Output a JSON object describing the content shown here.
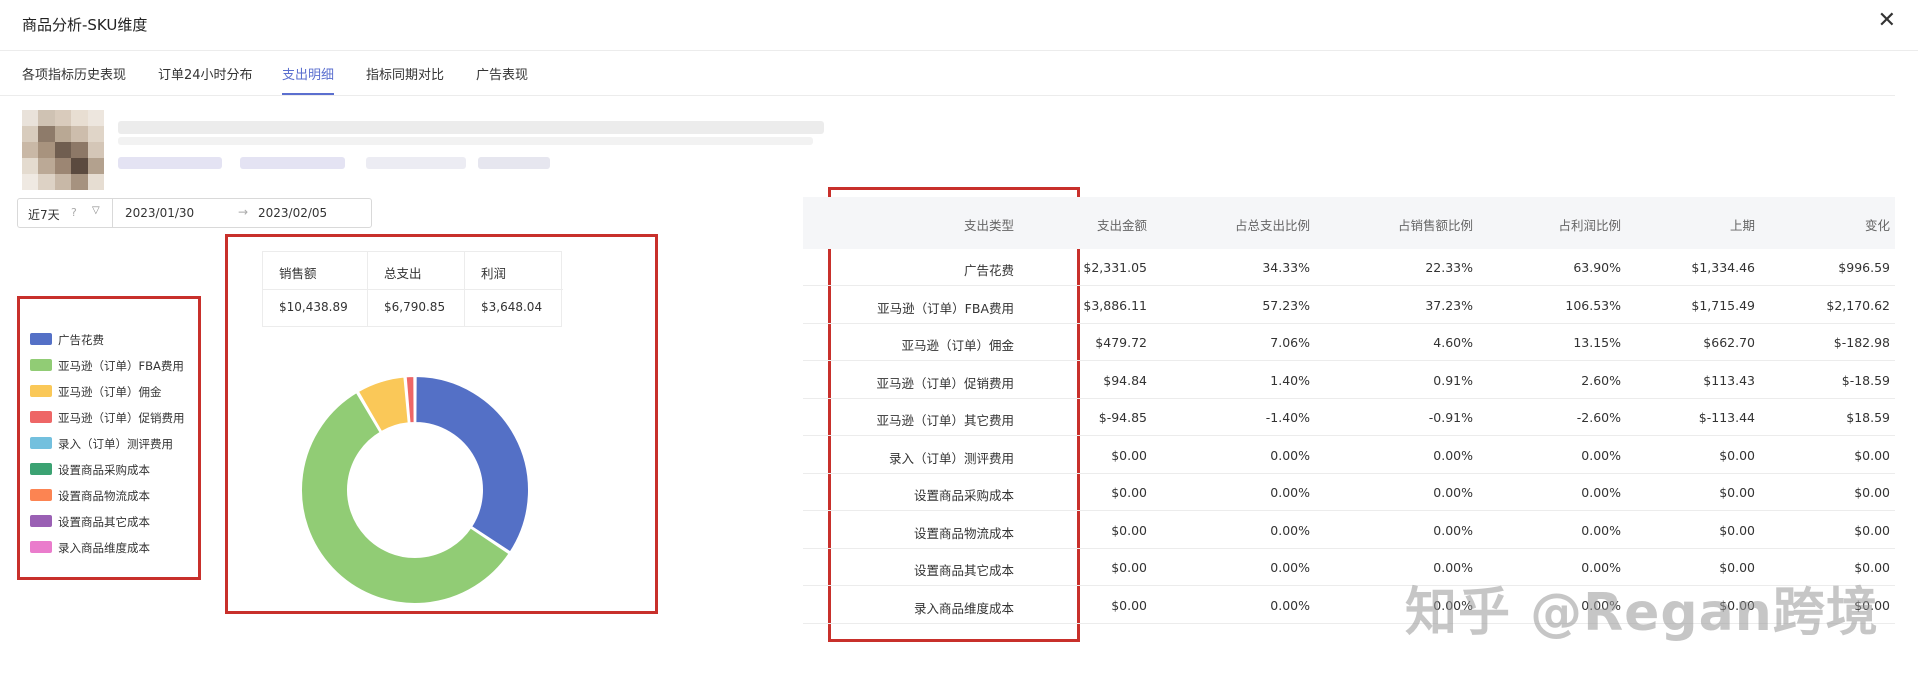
{
  "window": {
    "title": "商品分析-SKU维度",
    "close_label": "✕"
  },
  "tabs": [
    {
      "label": "各项指标历史表现"
    },
    {
      "label": "订单24小时分布"
    },
    {
      "label": "支出明细",
      "active": true
    },
    {
      "label": "指标同期对比"
    },
    {
      "label": "广告表现"
    }
  ],
  "date_range": {
    "preset": "近7天",
    "preset_icon": "help-circle-icon",
    "start": "2023/01/30",
    "arrow": "→",
    "end": "2023/02/05"
  },
  "legend": [
    {
      "label": "广告花费",
      "color": "#5470c6"
    },
    {
      "label": "亚马逊（订单）FBA费用",
      "color": "#91cc75"
    },
    {
      "label": "亚马逊（订单）佣金",
      "color": "#fac858"
    },
    {
      "label": "亚马逊（订单）促销费用",
      "color": "#ee6666"
    },
    {
      "label": "录入（订单）测评费用",
      "color": "#73c0de"
    },
    {
      "label": "设置商品采购成本",
      "color": "#3ba272"
    },
    {
      "label": "设置商品物流成本",
      "color": "#fc8452"
    },
    {
      "label": "设置商品其它成本",
      "color": "#9a60b4"
    },
    {
      "label": "录入商品维度成本",
      "color": "#ea7ccc"
    }
  ],
  "summary": {
    "headers": [
      "销售额",
      "总支出",
      "利润"
    ],
    "values": [
      "$10,438.89",
      "$6,790.85",
      "$3,648.04"
    ]
  },
  "chart_data": {
    "type": "pie",
    "donut": true,
    "labels": [
      "广告花费",
      "亚马逊（订单）FBA费用",
      "亚马逊（订单）佣金",
      "亚马逊（订单）促销费用",
      "亚马逊（订单）其它费用",
      "录入（订单）测评费用",
      "设置商品采购成本",
      "设置商品物流成本",
      "设置商品其它成本",
      "录入商品维度成本"
    ],
    "values": [
      2331.05,
      3886.11,
      479.72,
      94.84,
      -94.85,
      0,
      0,
      0,
      0,
      0
    ],
    "colors": [
      "#5470c6",
      "#91cc75",
      "#fac858",
      "#ee6666",
      "#73c0de",
      "#3ba272",
      "#fc8452",
      "#9a60b4",
      "#ea7ccc",
      "#5470c6"
    ]
  },
  "table": {
    "headers": [
      "支出类型",
      "支出金额",
      "占总支出比例",
      "占销售额比例",
      "占利润比例",
      "上期",
      "变化"
    ],
    "rows": [
      [
        "广告花费",
        "$2,331.05",
        "34.33%",
        "22.33%",
        "63.90%",
        "$1,334.46",
        "$996.59"
      ],
      [
        "亚马逊（订单）FBA费用",
        "$3,886.11",
        "57.23%",
        "37.23%",
        "106.53%",
        "$1,715.49",
        "$2,170.62"
      ],
      [
        "亚马逊（订单）佣金",
        "$479.72",
        "7.06%",
        "4.60%",
        "13.15%",
        "$662.70",
        "$-182.98"
      ],
      [
        "亚马逊（订单）促销费用",
        "$94.84",
        "1.40%",
        "0.91%",
        "2.60%",
        "$113.43",
        "$-18.59"
      ],
      [
        "亚马逊（订单）其它费用",
        "$-94.85",
        "-1.40%",
        "-0.91%",
        "-2.60%",
        "$-113.44",
        "$18.59"
      ],
      [
        "录入（订单）测评费用",
        "$0.00",
        "0.00%",
        "0.00%",
        "0.00%",
        "$0.00",
        "$0.00"
      ],
      [
        "设置商品采购成本",
        "$0.00",
        "0.00%",
        "0.00%",
        "0.00%",
        "$0.00",
        "$0.00"
      ],
      [
        "设置商品物流成本",
        "$0.00",
        "0.00%",
        "0.00%",
        "0.00%",
        "$0.00",
        "$0.00"
      ],
      [
        "设置商品其它成本",
        "$0.00",
        "0.00%",
        "0.00%",
        "0.00%",
        "$0.00",
        "$0.00"
      ],
      [
        "录入商品维度成本",
        "$0.00",
        "0.00%",
        "0.00%",
        "0.00%",
        "$0.00",
        "$0.00"
      ]
    ]
  },
  "watermark": "知乎 @Regan跨境"
}
